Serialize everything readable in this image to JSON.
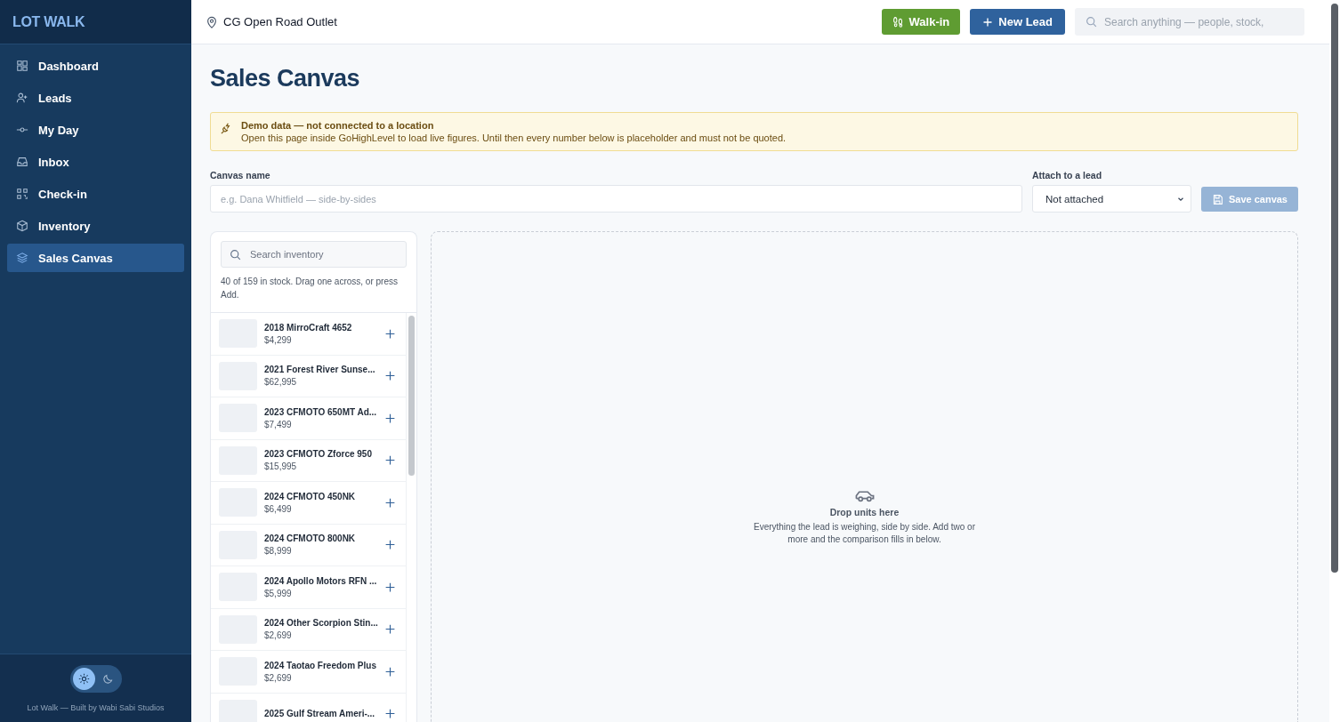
{
  "sidebar": {
    "logo": "LOT WALK",
    "items": [
      {
        "label": "Dashboard",
        "selected": false
      },
      {
        "label": "Leads",
        "selected": false
      },
      {
        "label": "My Day",
        "selected": false
      },
      {
        "label": "Inbox",
        "selected": false
      },
      {
        "label": "Check-in",
        "selected": false
      },
      {
        "label": "Inventory",
        "selected": false
      },
      {
        "label": "Sales Canvas",
        "selected": true
      }
    ],
    "theme_toggle": [
      {
        "kind": "light",
        "selected": true
      },
      {
        "kind": "dark",
        "selected": false
      }
    ],
    "footer": "Lot Walk — Built by Wabi Sabi Studios"
  },
  "header": {
    "location": "CG Open Road Outlet",
    "walk_in_button": "Walk-in",
    "new_lead_button": "New Lead",
    "search": {
      "placeholder": "Search anything — people, stock,"
    }
  },
  "page": {
    "title": "Sales Canvas",
    "notice": {
      "title": "Demo data — not connected to a location",
      "text": "Open this page inside GoHighLevel to load live figures. Until then every number below is placeholder and must not be quoted."
    },
    "canvas_name": {
      "label": "Canvas name",
      "placeholder": "e.g. Dana Whitfield — side-by-sides"
    },
    "attach": {
      "label": "Attach to a lead",
      "value": "Not attached"
    },
    "save_button": {
      "label": "Save canvas",
      "disabled": true
    },
    "inventory": {
      "search": {
        "placeholder": "Search inventory"
      },
      "count": "40 of 159 in stock. Drag one across, or press Add.",
      "items": [
        {
          "name": "2018 MirroCraft 4652",
          "price": "$4,299"
        },
        {
          "name": "2021 Forest River Sunse...",
          "price": "$62,995"
        },
        {
          "name": "2023 CFMOTO 650MT Ad...",
          "price": "$7,499"
        },
        {
          "name": "2023 CFMOTO Zforce 950",
          "price": "$15,995"
        },
        {
          "name": "2024 CFMOTO 450NK",
          "price": "$6,499"
        },
        {
          "name": "2024 CFMOTO 800NK",
          "price": "$8,999"
        },
        {
          "name": "2024 Apollo Motors RFN ...",
          "price": "$5,999"
        },
        {
          "name": "2024 Other Scorpion Stin...",
          "price": "$2,699"
        },
        {
          "name": "2024 Taotao Freedom Plus",
          "price": "$2,699"
        },
        {
          "name": "2025 Gulf Stream Ameri-..."
        }
      ]
    },
    "drop_zone": {
      "title": "Drop units here",
      "text": "Everything the lead is weighing, side by side. Add two or more and the comparison fills in below."
    }
  }
}
